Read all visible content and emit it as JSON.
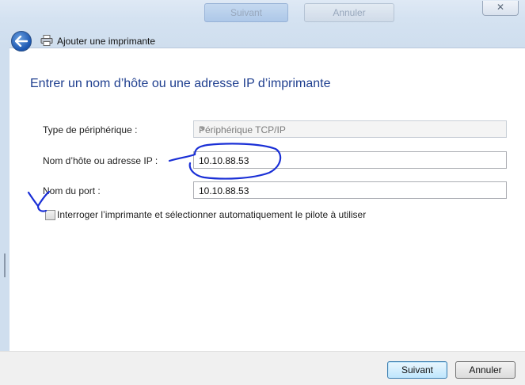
{
  "background_buttons": {
    "next": "Suivant",
    "cancel": "Annuler"
  },
  "window": {
    "title": "Ajouter une imprimante",
    "close_glyph": "✕",
    "back_icon": "back-arrow-icon",
    "printer_icon": "printer-icon"
  },
  "page": {
    "heading": "Entrer un nom d’hôte ou une adresse IP d’imprimante"
  },
  "form": {
    "device_type": {
      "label": "Type de périphérique :",
      "value": "Périphérique TCP/IP"
    },
    "hostname": {
      "label": "Nom d’hôte ou adresse IP :",
      "value": "10.10.88.53"
    },
    "port": {
      "label": "Nom du port :",
      "value": "10.10.88.53"
    },
    "query_checkbox": {
      "label": "Interroger l’imprimante et sélectionner automatiquement le pilote à utiliser",
      "checked": false
    }
  },
  "footer": {
    "next": "Suivant",
    "cancel": "Annuler"
  },
  "colors": {
    "heading": "#1f3f8f",
    "annotation_ink": "#1a2fd6",
    "glass": "#d4e2f1"
  }
}
